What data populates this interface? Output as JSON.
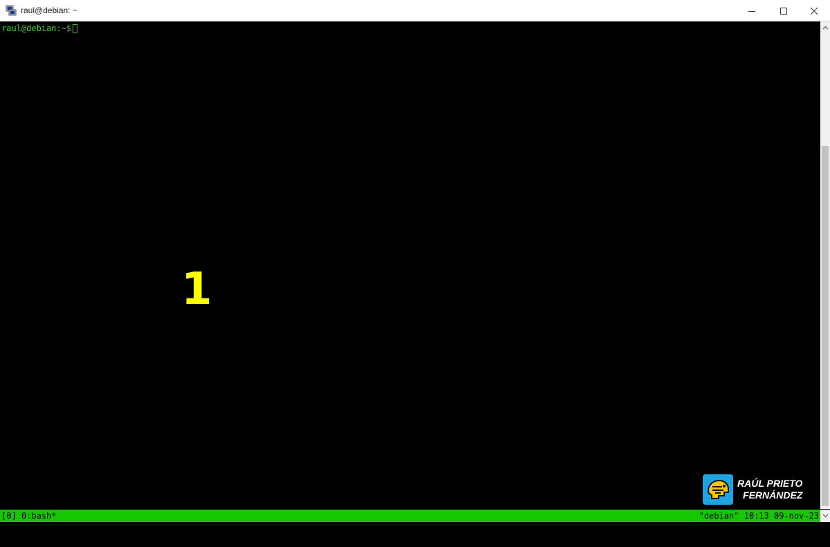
{
  "window": {
    "title": "raul@debian: ~",
    "icon": "putty-terminal-icon",
    "buttons": {
      "minimize": "—",
      "maximize": "☐",
      "close": "✕"
    }
  },
  "terminal": {
    "prompt_user": "raul@debian",
    "prompt_sep": ":",
    "prompt_path": "~",
    "prompt_symbol": "$",
    "overlay_number": "1"
  },
  "logo": {
    "line1": "RAÚL PRIETO",
    "line2": "FERNÁNDEZ",
    "icon": "helmet-logo-icon"
  },
  "statusbar": {
    "left": "[0] 0:bash*",
    "right": "\"debian\" 10:13 09-nov-23"
  },
  "colors": {
    "prompt": "#3ed22b",
    "status_bg": "#15c700",
    "overlay": "#ffff00",
    "logo_bg": "#1ea5e0"
  }
}
